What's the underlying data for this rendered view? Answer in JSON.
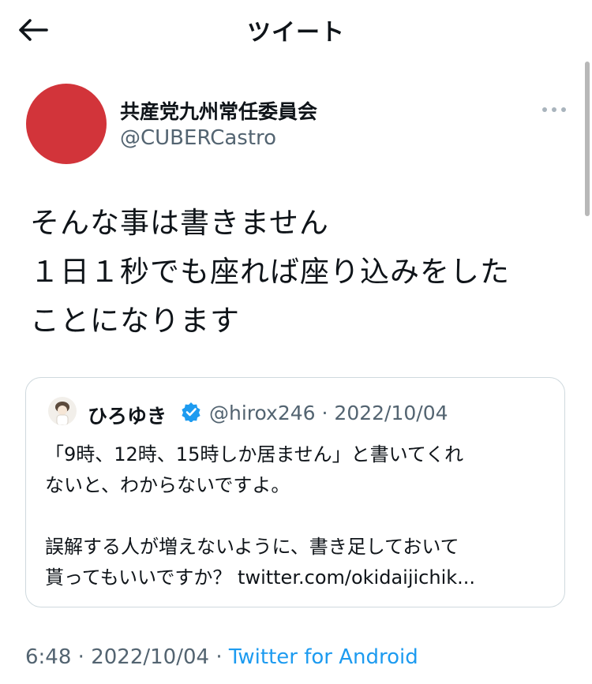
{
  "header": {
    "title": "ツイート"
  },
  "tweet": {
    "display_name": "共産党九州常任委員会",
    "handle": "@CUBERCastro",
    "avatar_color": "#d2343a",
    "lines": [
      "そんな事は書きません",
      "１日１秒でも座れば座り込みをした",
      "ことになります"
    ],
    "time": "6:48",
    "date": "2022/10/04",
    "separator": "·",
    "source": "Twitter for Android"
  },
  "quote": {
    "display_name": "ひろゆき",
    "verified": true,
    "handle": "@hirox246",
    "separator": "·",
    "date": "2022/10/04",
    "lines": [
      "「9時、12時、15時しか居ません」と書いてくれ",
      "ないと、わからないですよ。",
      "",
      "誤解する人が増えないように、書き足しておいて",
      "貰ってもいいですか？ "
    ],
    "link_text": "twitter.com/okidaijichik..."
  },
  "colors": {
    "text": "#0f1419",
    "secondary": "#536471",
    "accent": "#1d9bf0",
    "border": "#cfd9de"
  },
  "icons": [
    "back-arrow-icon",
    "more-options-icon",
    "verified-badge-icon"
  ]
}
